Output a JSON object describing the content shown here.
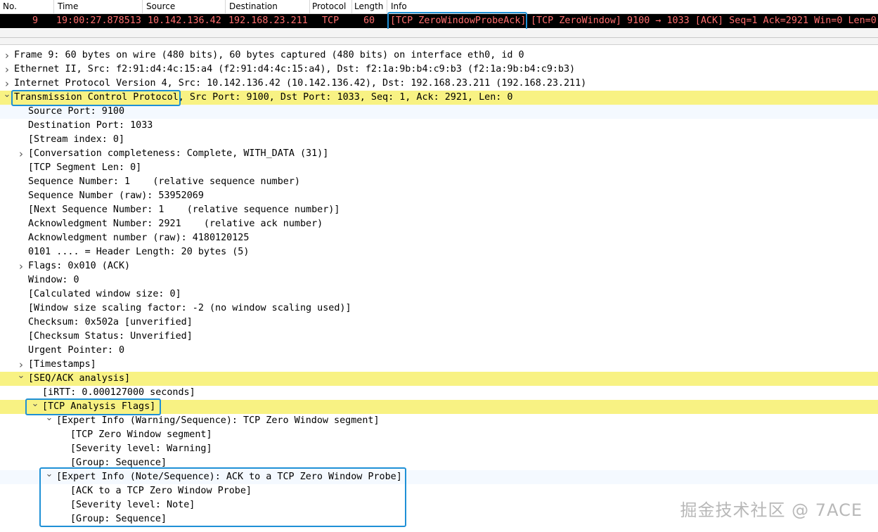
{
  "columns": [
    "No.",
    "Time",
    "Source",
    "Destination",
    "Protocol",
    "Length",
    "Info"
  ],
  "packet": {
    "no": "9",
    "time": "19:00:27.878513",
    "source": "10.142.136.42",
    "destination": "192.168.23.211",
    "protocol": "TCP",
    "length": "60",
    "info_tag": "[TCP ZeroWindowProbeAck]",
    "info_rest": "[TCP ZeroWindow] 9100 → 1033 [ACK] Seq=1 Ack=2921 Win=0 Len=0"
  },
  "tree": [
    {
      "text": "Frame 9: 60 bytes on wire (480 bits), 60 bytes captured (480 bits) on interface eth0, id 0",
      "level": 0,
      "arrow": "collapsed"
    },
    {
      "text": "Ethernet II, Src: f2:91:d4:4c:15:a4 (f2:91:d4:4c:15:a4), Dst: f2:1a:9b:b4:c9:b3 (f2:1a:9b:b4:c9:b3)",
      "level": 0,
      "arrow": "collapsed"
    },
    {
      "text": "Internet Protocol Version 4, Src: 10.142.136.42 (10.142.136.42), Dst: 192.168.23.211 (192.168.23.211)",
      "level": 0,
      "arrow": "collapsed"
    },
    {
      "text": "Transmission Control Protocol, Src Port: 9100, Dst Port: 1033, Seq: 1, Ack: 2921, Len: 0",
      "level": 0,
      "arrow": "expanded",
      "highlight": true
    },
    {
      "text": "Source Port: 9100",
      "level": 1,
      "selected": true
    },
    {
      "text": "Destination Port: 1033",
      "level": 1
    },
    {
      "text": "[Stream index: 0]",
      "level": 1
    },
    {
      "text": "[Conversation completeness: Complete, WITH_DATA (31)]",
      "level": 1,
      "arrow": "collapsed"
    },
    {
      "text": "[TCP Segment Len: 0]",
      "level": 1
    },
    {
      "text": "Sequence Number: 1    (relative sequence number)",
      "level": 1
    },
    {
      "text": "Sequence Number (raw): 53952069",
      "level": 1
    },
    {
      "text": "[Next Sequence Number: 1    (relative sequence number)]",
      "level": 1
    },
    {
      "text": "Acknowledgment Number: 2921    (relative ack number)",
      "level": 1
    },
    {
      "text": "Acknowledgment number (raw): 4180120125",
      "level": 1
    },
    {
      "text": "0101 .... = Header Length: 20 bytes (5)",
      "level": 1
    },
    {
      "text": "Flags: 0x010 (ACK)",
      "level": 1,
      "arrow": "collapsed"
    },
    {
      "text": "Window: 0",
      "level": 1
    },
    {
      "text": "[Calculated window size: 0]",
      "level": 1
    },
    {
      "text": "[Window size scaling factor: -2 (no window scaling used)]",
      "level": 1
    },
    {
      "text": "Checksum: 0x502a [unverified]",
      "level": 1
    },
    {
      "text": "[Checksum Status: Unverified]",
      "level": 1
    },
    {
      "text": "Urgent Pointer: 0",
      "level": 1
    },
    {
      "text": "[Timestamps]",
      "level": 1,
      "arrow": "collapsed"
    },
    {
      "text": "[SEQ/ACK analysis]",
      "level": 1,
      "arrow": "expanded",
      "highlight": true
    },
    {
      "text": "[iRTT: 0.000127000 seconds]",
      "level": 2
    },
    {
      "text": "[TCP Analysis Flags]",
      "level": 2,
      "arrow": "expanded",
      "highlight": true
    },
    {
      "text": "[Expert Info (Warning/Sequence): TCP Zero Window segment]",
      "level": 3,
      "arrow": "expanded"
    },
    {
      "text": "[TCP Zero Window segment]",
      "level": 4
    },
    {
      "text": "[Severity level: Warning]",
      "level": 4
    },
    {
      "text": "[Group: Sequence]",
      "level": 4
    },
    {
      "text": "[Expert Info (Note/Sequence): ACK to a TCP Zero Window Probe]",
      "level": 3,
      "arrow": "expanded",
      "selected": true
    },
    {
      "text": "[ACK to a TCP Zero Window Probe]",
      "level": 4
    },
    {
      "text": "[Severity level: Note]",
      "level": 4
    },
    {
      "text": "[Group: Sequence]",
      "level": 4
    }
  ],
  "watermark": "掘金技术社区 @ 7ACE",
  "colors": {
    "highlight": "#f8f283",
    "box": "#1e90d6",
    "packet_fg": "#ff6e6e"
  }
}
